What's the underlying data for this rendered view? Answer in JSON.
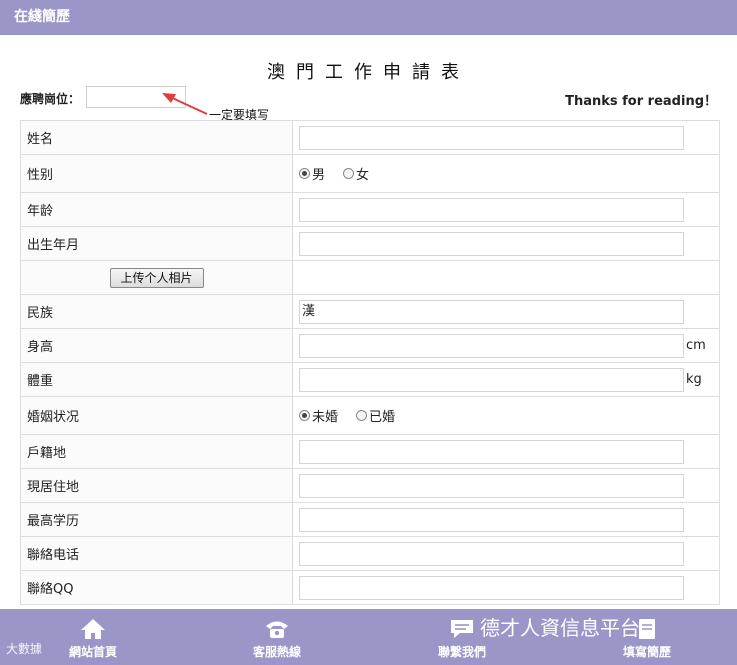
{
  "header": {
    "title": "在綫簡歷"
  },
  "form": {
    "heading": "澳門工作申請表",
    "position_label": "應聘崗位：",
    "position_value": "",
    "required_note": "一定要填写",
    "thanks": "Thanks for reading！",
    "rows": {
      "name": {
        "label": "姓名",
        "value": ""
      },
      "gender": {
        "label": "性别",
        "options": [
          "男",
          "女"
        ],
        "selected": "男"
      },
      "age": {
        "label": "年龄",
        "value": ""
      },
      "birth": {
        "label": "出生年月",
        "value": ""
      },
      "photo": {
        "button": "上传个人相片"
      },
      "ethnicity": {
        "label": "民族",
        "value": "漢"
      },
      "height": {
        "label": "身高",
        "value": "",
        "unit": "cm"
      },
      "weight": {
        "label": "體重",
        "value": "",
        "unit": "kg"
      },
      "marital": {
        "label": "婚姻状况",
        "options": [
          "未婚",
          "已婚"
        ],
        "selected": "未婚"
      },
      "hukou": {
        "label": "戶籍地",
        "value": ""
      },
      "address": {
        "label": "現居住地",
        "value": ""
      },
      "education": {
        "label": "最高学历",
        "value": ""
      },
      "phone": {
        "label": "聯絡电话",
        "value": ""
      },
      "qq": {
        "label": "聯絡QQ",
        "value": ""
      }
    }
  },
  "bottom_nav": {
    "home": "網站首頁",
    "hotline": "客服熱線",
    "contact": "聯繫我們",
    "resume": "填寫簡歷"
  },
  "watermark": {
    "main": "德才人資信息平台",
    "corner": "大數據"
  },
  "colors": {
    "bar": "#9a96c8",
    "arrow": "#e03c3c"
  }
}
